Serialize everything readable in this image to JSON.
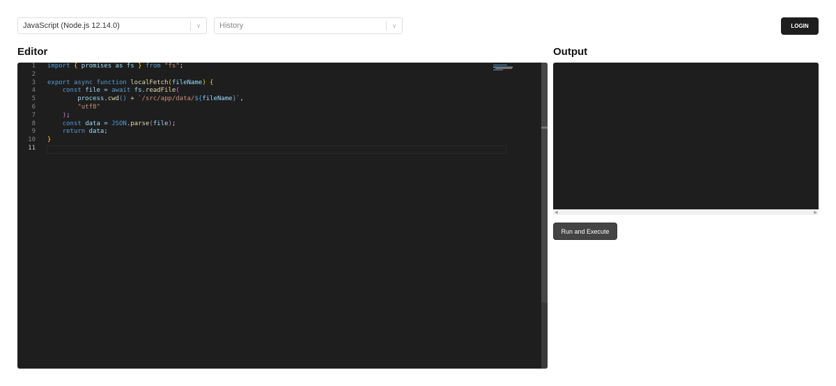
{
  "toolbar": {
    "language_value": "JavaScript (Node.js 12.14.0)",
    "history_placeholder": "History",
    "login_label": "LOGIN"
  },
  "editor": {
    "title": "Editor",
    "lines": [
      {
        "n": "1",
        "tokens": [
          [
            "import",
            "kw"
          ],
          [
            " ",
            "pu"
          ],
          [
            "{",
            "br"
          ],
          [
            " promises as fs ",
            "va"
          ],
          [
            "}",
            "br"
          ],
          [
            " ",
            "pu"
          ],
          [
            "from",
            "kw"
          ],
          [
            " ",
            "pu"
          ],
          [
            "\"fs\"",
            "st"
          ],
          [
            ";",
            "pu"
          ]
        ]
      },
      {
        "n": "2",
        "tokens": []
      },
      {
        "n": "3",
        "tokens": [
          [
            "export",
            "kw"
          ],
          [
            " ",
            "pu"
          ],
          [
            "async",
            "kw"
          ],
          [
            " ",
            "pu"
          ],
          [
            "function",
            "kw"
          ],
          [
            " ",
            "pu"
          ],
          [
            "localFetch",
            "fn"
          ],
          [
            "(",
            "br"
          ],
          [
            "fileName",
            "va"
          ],
          [
            ")",
            "br"
          ],
          [
            " ",
            "pu"
          ],
          [
            "{",
            "br"
          ]
        ]
      },
      {
        "n": "4",
        "tokens": [
          [
            "    ",
            "pu"
          ],
          [
            "const",
            "kw"
          ],
          [
            " file = ",
            "va"
          ],
          [
            "await",
            "kw"
          ],
          [
            " fs.",
            "va"
          ],
          [
            "readFile",
            "fn"
          ],
          [
            "(",
            "pk"
          ]
        ]
      },
      {
        "n": "5",
        "tokens": [
          [
            "        process.",
            "va"
          ],
          [
            "cwd",
            "fn"
          ],
          [
            "()",
            "kw"
          ],
          [
            " + ",
            "pu"
          ],
          [
            "`/src/app/data/",
            "st"
          ],
          [
            "${",
            "kw"
          ],
          [
            "fileName",
            "va"
          ],
          [
            "}",
            "kw"
          ],
          [
            "`",
            "st"
          ],
          [
            ",",
            "pu"
          ]
        ]
      },
      {
        "n": "6",
        "tokens": [
          [
            "        ",
            "pu"
          ],
          [
            "\"utf8\"",
            "st"
          ]
        ]
      },
      {
        "n": "7",
        "tokens": [
          [
            "    ",
            "pu"
          ],
          [
            ")",
            "pk"
          ],
          [
            ";",
            "pu"
          ]
        ]
      },
      {
        "n": "8",
        "tokens": [
          [
            "    ",
            "pu"
          ],
          [
            "const",
            "kw"
          ],
          [
            " data = ",
            "va"
          ],
          [
            "JSON",
            "kw"
          ],
          [
            ".",
            "pu"
          ],
          [
            "parse",
            "fn"
          ],
          [
            "(",
            "pk"
          ],
          [
            "file",
            "va"
          ],
          [
            ")",
            "pk"
          ],
          [
            ";",
            "pu"
          ]
        ]
      },
      {
        "n": "9",
        "tokens": [
          [
            "    ",
            "pu"
          ],
          [
            "return",
            "kw"
          ],
          [
            " data;",
            "va"
          ]
        ]
      },
      {
        "n": "10",
        "tokens": [
          [
            "}",
            "br"
          ]
        ]
      },
      {
        "n": "11",
        "tokens": []
      }
    ]
  },
  "output": {
    "title": "Output",
    "run_label": "Run and Execute"
  },
  "colors": {
    "editor_bg": "#1e1e1e",
    "keyword": "#569cd6",
    "string": "#ce9178",
    "function": "#dcdcaa"
  }
}
